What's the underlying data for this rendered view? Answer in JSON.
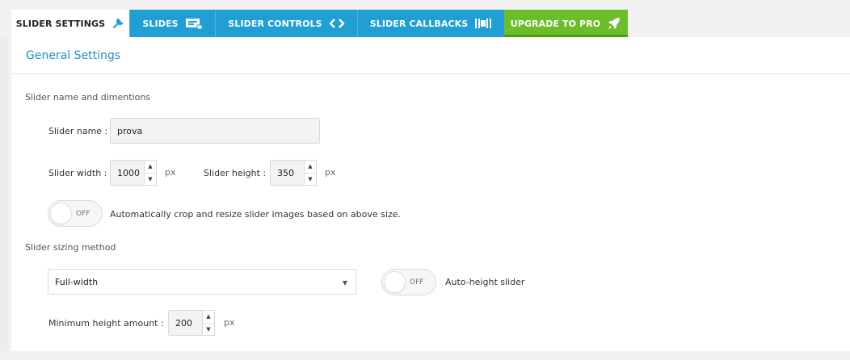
{
  "tabs": [
    {
      "label": "SLIDER SETTINGS",
      "icon": "wrench-icon"
    },
    {
      "label": "SLIDES",
      "icon": "slides-icon"
    },
    {
      "label": "SLIDER CONTROLS",
      "icon": "arrows-icon"
    },
    {
      "label": "SLIDER CALLBACKS",
      "icon": "callbacks-icon"
    },
    {
      "label": "UPGRADE TO PRO",
      "icon": "rocket-icon"
    }
  ],
  "colors": {
    "tab_blue": "#1f9fd4",
    "tab_green": "#6cbd2a",
    "title": "#1f8fc4"
  },
  "panel": {
    "title": "General Settings"
  },
  "dimensions": {
    "section_label": "Slider name and dimentions",
    "name_label": "Slider name :",
    "name_value": "prova",
    "width_label": "Slider width :",
    "width_value": "1000",
    "height_label": "Slider height :",
    "height_value": "350",
    "unit": "px",
    "crop_toggle_state": "OFF",
    "crop_label": "Automatically crop and resize slider images based on above size."
  },
  "sizing": {
    "section_label": "Slider sizing method",
    "method_value": "Full-width",
    "auto_height_toggle_state": "OFF",
    "auto_height_label": "Auto-height slider",
    "min_height_label": "Minimum height amount :",
    "min_height_value": "200",
    "unit": "px"
  }
}
